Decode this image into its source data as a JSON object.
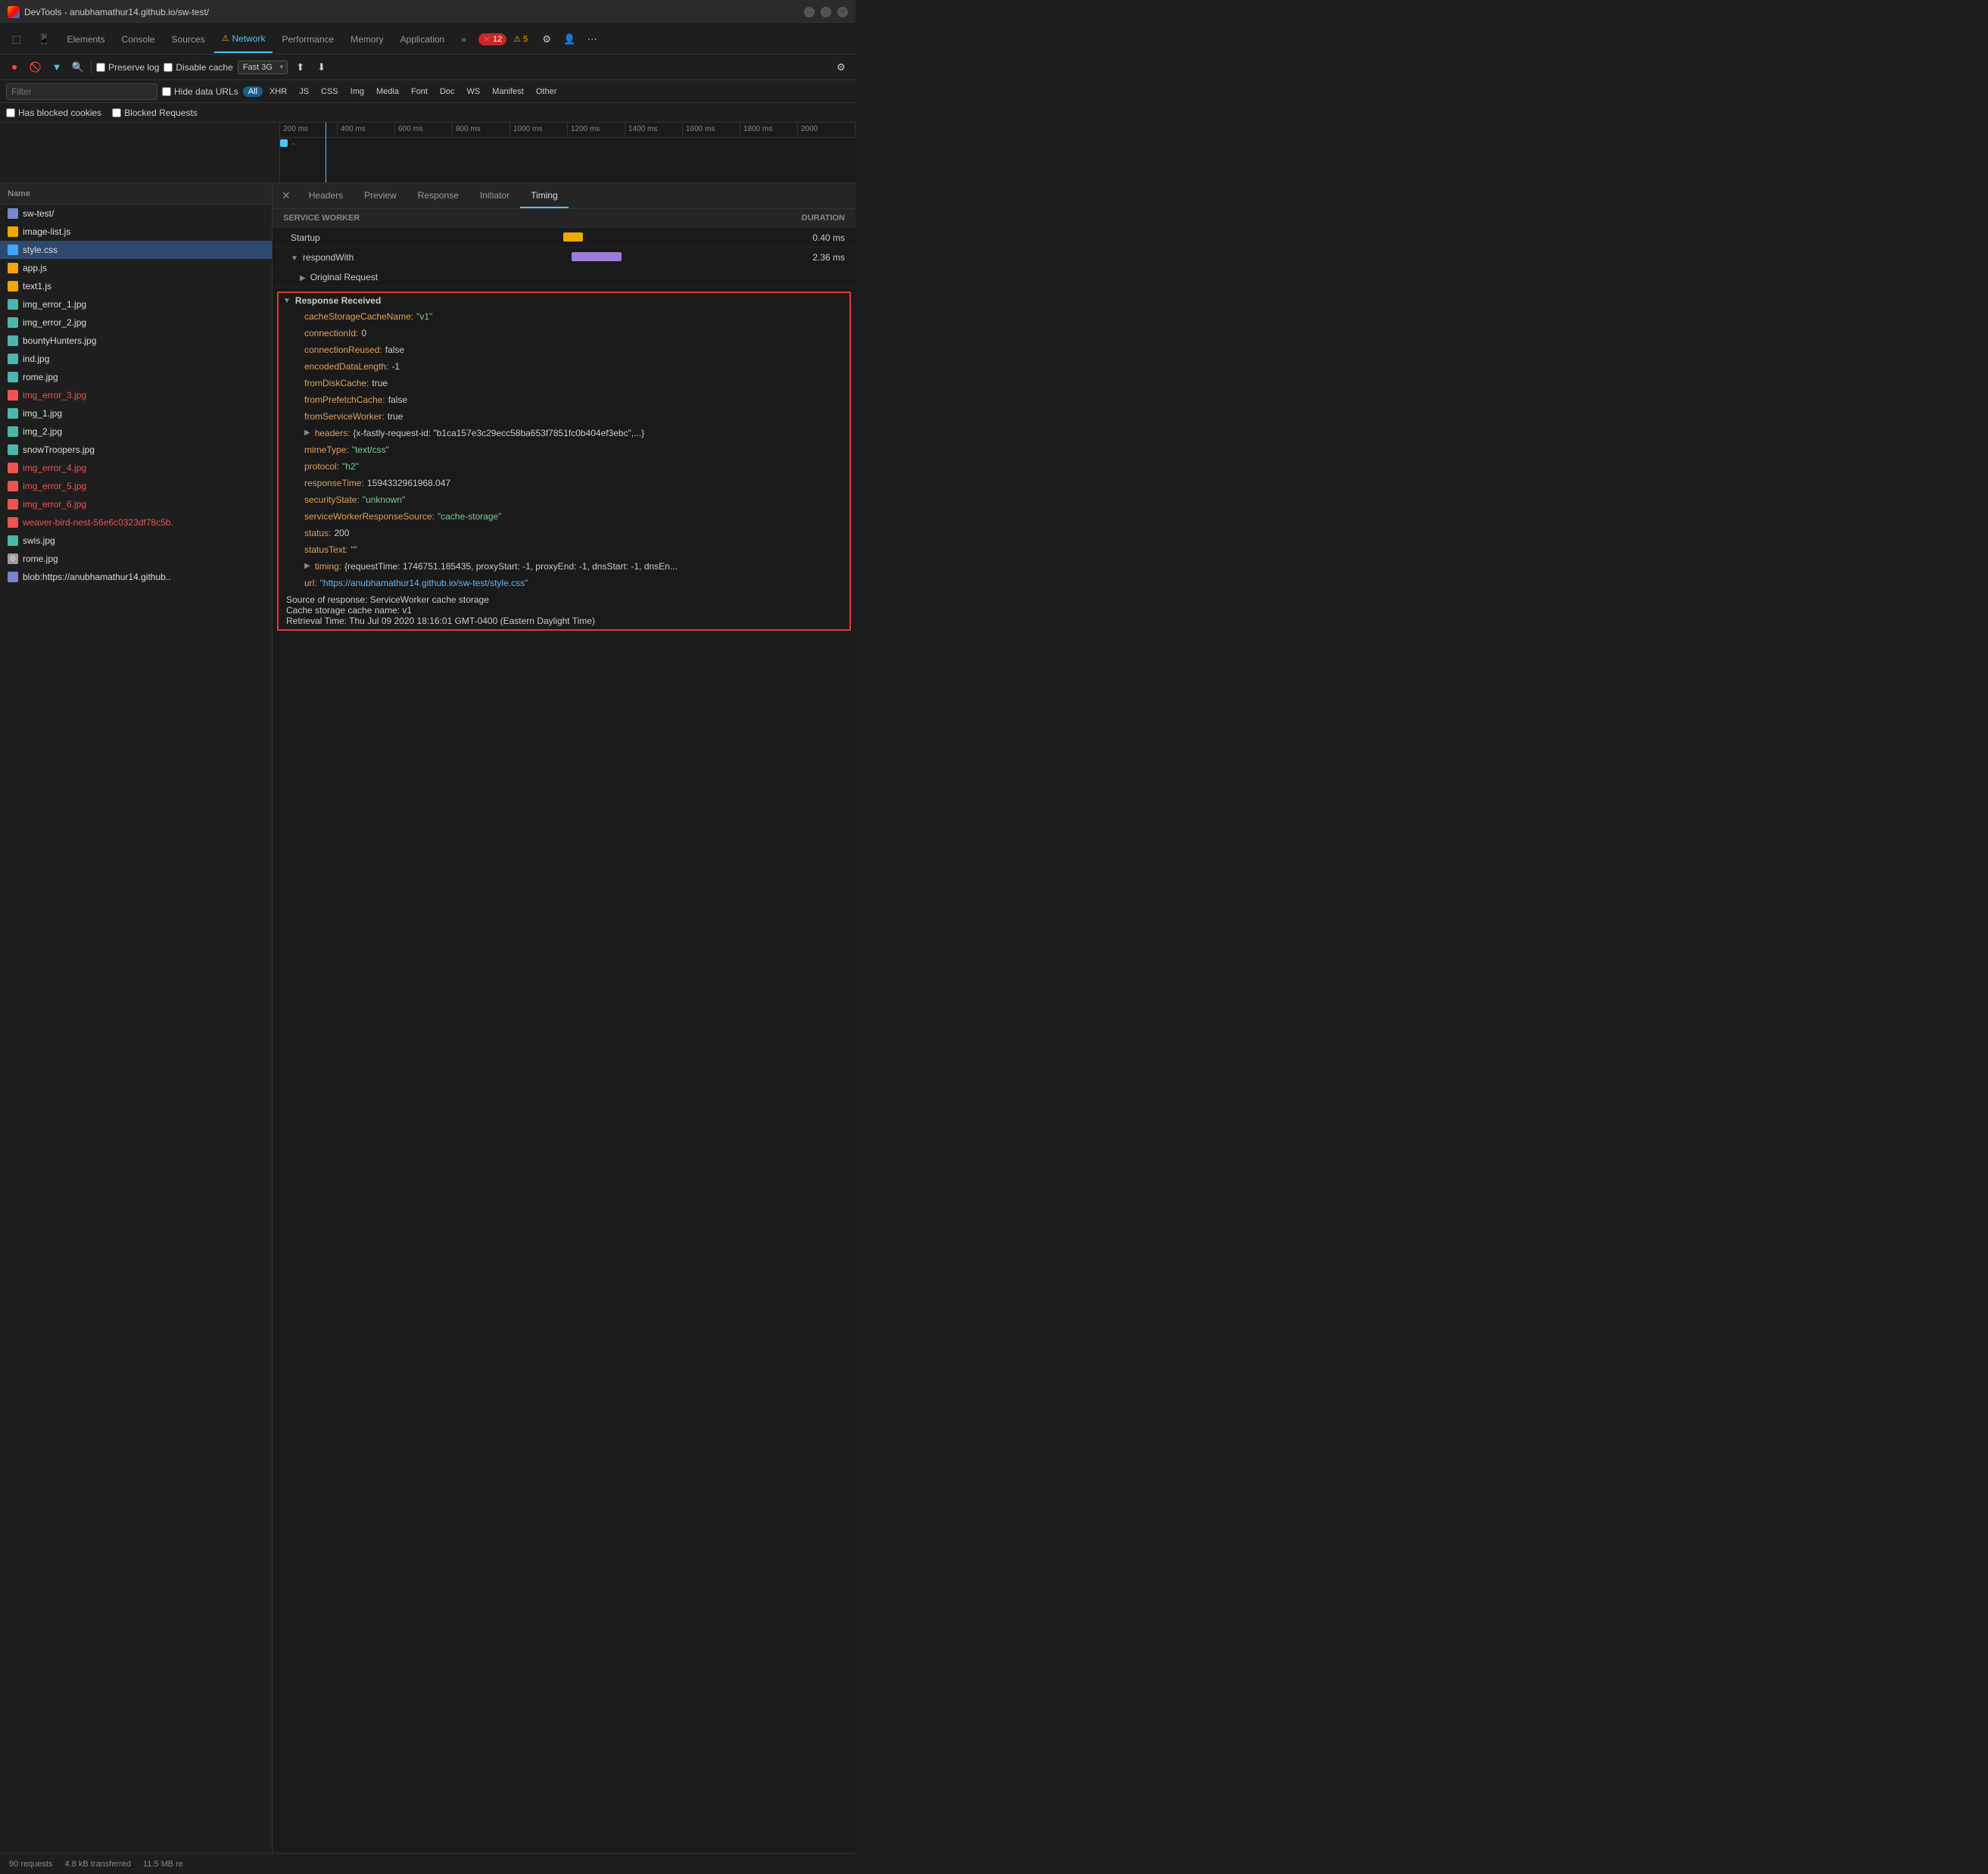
{
  "window": {
    "title": "DevTools - anubhamathur14.github.io/sw-test/"
  },
  "tabs": [
    {
      "label": "Elements",
      "active": false
    },
    {
      "label": "Console",
      "active": false
    },
    {
      "label": "Sources",
      "active": false
    },
    {
      "label": "Network",
      "active": true,
      "warn": true
    },
    {
      "label": "Performance",
      "active": false
    },
    {
      "label": "Memory",
      "active": false
    },
    {
      "label": "Application",
      "active": false
    }
  ],
  "badges": {
    "errors": "12",
    "warnings": "5"
  },
  "toolbar": {
    "preserve_log": "Preserve log",
    "disable_cache": "Disable cache",
    "throttle": "Fast 3G"
  },
  "filter_bar": {
    "placeholder": "Filter",
    "hide_data_urls": "Hide data URLs",
    "types": [
      "All",
      "XHR",
      "JS",
      "CSS",
      "Img",
      "Media",
      "Font",
      "Doc",
      "WS",
      "Manifest",
      "Other"
    ],
    "active_type": "All"
  },
  "blocked_bar": {
    "has_blocked": "Has blocked cookies",
    "blocked_requests": "Blocked Requests"
  },
  "timeline": {
    "ticks": [
      "200 ms",
      "400 ms",
      "600 ms",
      "800 ms",
      "1000 ms",
      "1200 ms",
      "1400 ms",
      "1600 ms",
      "1800 ms",
      "2000"
    ]
  },
  "file_list": {
    "header": "Name",
    "files": [
      {
        "name": "sw-test/",
        "type": "doc",
        "error": false
      },
      {
        "name": "image-list.js",
        "type": "js",
        "error": false
      },
      {
        "name": "style.css",
        "type": "css",
        "error": false,
        "active": true
      },
      {
        "name": "app.js",
        "type": "js",
        "error": false
      },
      {
        "name": "text1.js",
        "type": "js",
        "error": false
      },
      {
        "name": "img_error_1.jpg",
        "type": "img-err",
        "error": false
      },
      {
        "name": "img_error_2.jpg",
        "type": "img-err",
        "error": false
      },
      {
        "name": "bountyHunters.jpg",
        "type": "img",
        "error": false
      },
      {
        "name": "ind.jpg",
        "type": "img",
        "error": false
      },
      {
        "name": "rome.jpg",
        "type": "img",
        "error": false
      },
      {
        "name": "img_error_3.jpg",
        "type": "img-err",
        "error": true
      },
      {
        "name": "img_1.jpg",
        "type": "img",
        "error": false
      },
      {
        "name": "img_2.jpg",
        "type": "img",
        "error": false
      },
      {
        "name": "snowTroopers.jpg",
        "type": "img",
        "error": false
      },
      {
        "name": "img_error_4.jpg",
        "type": "img-err",
        "error": true
      },
      {
        "name": "img_error_5.jpg",
        "type": "img-err",
        "error": true
      },
      {
        "name": "img_error_6.jpg",
        "type": "img-err",
        "error": true
      },
      {
        "name": "weaver-bird-nest-56e6c0323df78c5b.",
        "type": "img",
        "error": true
      },
      {
        "name": "swis.jpg",
        "type": "img",
        "error": false
      },
      {
        "name": "rome.jpg",
        "type": "gear",
        "error": false
      },
      {
        "name": "blob:https://anubhamathur14.github..",
        "type": "doc",
        "error": false
      }
    ]
  },
  "panel_tabs": [
    "Headers",
    "Preview",
    "Response",
    "Initiator",
    "Timing"
  ],
  "active_panel_tab": "Timing",
  "timing": {
    "section_header": "Service Worker",
    "duration_label": "DURATION",
    "rows": [
      {
        "label": "Startup",
        "bar_color": "#f0a800",
        "bar_left": "45%",
        "bar_width": "5%",
        "value": "0.40 ms"
      },
      {
        "label": "respondWith",
        "bar_color": "#9c7cd6",
        "bar_left": "47%",
        "bar_width": "12%",
        "value": "2.36 ms"
      }
    ],
    "original_request": "Original Request"
  },
  "response_received": {
    "title": "Response Received",
    "fields": [
      {
        "key": "cacheStorageCacheName:",
        "val": "\"v1\"",
        "type": "string"
      },
      {
        "key": "connectionId:",
        "val": "0",
        "type": "num"
      },
      {
        "key": "connectionReused:",
        "val": "false",
        "type": "num"
      },
      {
        "key": "encodedDataLength:",
        "val": "-1",
        "type": "num"
      },
      {
        "key": "fromDiskCache:",
        "val": "true",
        "type": "num"
      },
      {
        "key": "fromPrefetchCache:",
        "val": "false",
        "type": "num"
      },
      {
        "key": "fromServiceWorker:",
        "val": "true",
        "type": "num"
      },
      {
        "key": "headers:",
        "val": "{x-fastly-request-id: \"b1ca157e3c29ecc58ba653f7851fc0b404ef3ebc\",...}",
        "type": "num"
      },
      {
        "key": "mimeType:",
        "val": "\"text/css\"",
        "type": "string"
      },
      {
        "key": "protocol:",
        "val": "\"h2\"",
        "type": "string"
      },
      {
        "key": "responseTime:",
        "val": "1594332961968.047",
        "type": "num"
      },
      {
        "key": "securityState:",
        "val": "\"unknown\"",
        "type": "string"
      },
      {
        "key": "serviceWorkerResponseSource:",
        "val": "\"cache-storage\"",
        "type": "string"
      },
      {
        "key": "status:",
        "val": "200",
        "type": "num"
      },
      {
        "key": "statusText:",
        "val": "\"\"",
        "type": "string"
      },
      {
        "key": "timing:",
        "val": "{requestTime: 1746751.185435, proxyStart: -1, proxyEnd: -1, dnsStart: -1, dnsEn...",
        "type": "num"
      },
      {
        "key": "url:",
        "val": "\"https://anubhamathur14.github.io/sw-test/style.css\"",
        "type": "blue"
      }
    ],
    "source_of_response": "Source of response: ServiceWorker cache storage",
    "cache_name": "Cache storage cache name: v1",
    "retrieval_time": "Retrieval Time: Thu Jul 09 2020 18:16:01 GMT-0400 (Eastern Daylight Time)"
  },
  "status_bar": {
    "requests": "90 requests",
    "transferred": "4.8 kB transferred",
    "size": "11.5 MB re"
  }
}
